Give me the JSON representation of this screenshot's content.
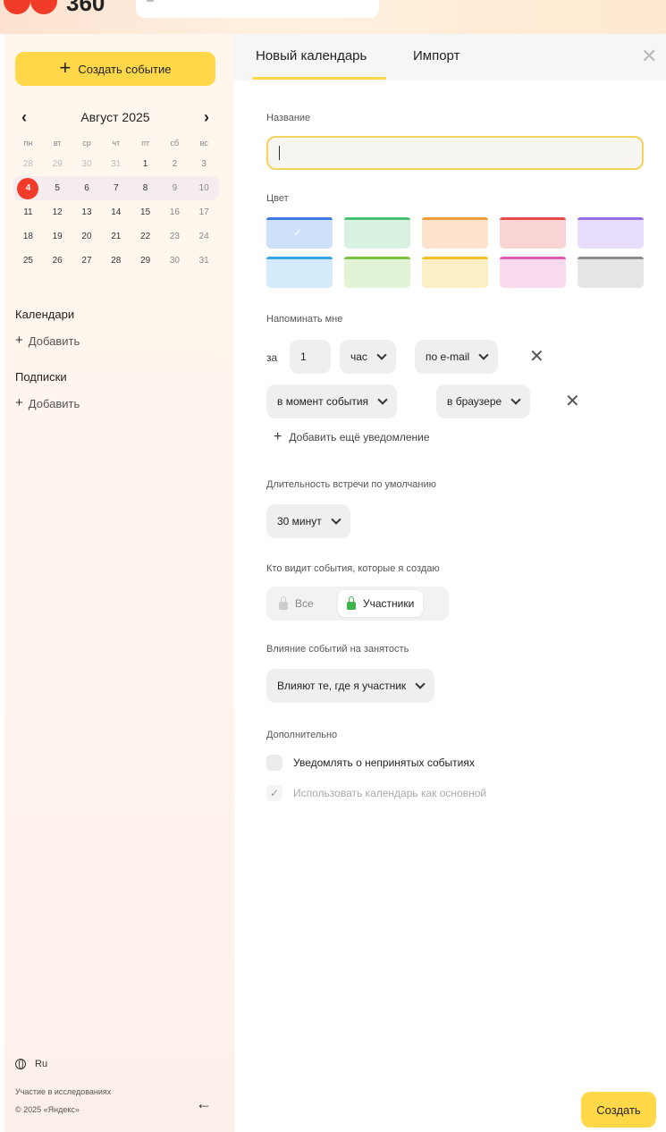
{
  "header": {
    "logo_text": "360"
  },
  "sidebar": {
    "create_button_label": "Создать событие",
    "calendar": {
      "month_label": "Август 2025",
      "weekdays": [
        "пн",
        "вт",
        "ср",
        "чт",
        "пт",
        "сб",
        "вс"
      ],
      "weeks": [
        [
          "28",
          "29",
          "30",
          "31",
          "1",
          "2",
          "3"
        ],
        [
          "4",
          "5",
          "6",
          "7",
          "8",
          "9",
          "10"
        ],
        [
          "11",
          "12",
          "13",
          "14",
          "15",
          "16",
          "17"
        ],
        [
          "18",
          "19",
          "20",
          "21",
          "22",
          "23",
          "24"
        ],
        [
          "25",
          "26",
          "27",
          "28",
          "29",
          "30",
          "31"
        ]
      ],
      "today": "4"
    },
    "calendars_title": "Календари",
    "calendars_add": "Добавить",
    "subscriptions_title": "Подписки",
    "subscriptions_add": "Добавить",
    "language": "Ru",
    "research_link": "Участие в исследованиях",
    "copyright": "© 2025 «Яндекс»"
  },
  "panel": {
    "tabs": [
      "Новый календарь",
      "Импорт"
    ],
    "name_label": "Название",
    "name_value": "",
    "color_label": "Цвет",
    "colors": [
      {
        "bg": "#cfe0fb",
        "bar": "#3a7be6"
      },
      {
        "bg": "#d9f2e1",
        "bar": "#46c16f"
      },
      {
        "bg": "#fde3cc",
        "bar": "#f39a3a"
      },
      {
        "bg": "#f9d4d4",
        "bar": "#e54b4b"
      },
      {
        "bg": "#e8dcfb",
        "bar": "#9a6de8"
      },
      {
        "bg": "#d3ebfa",
        "bar": "#34a4e4"
      },
      {
        "bg": "#e3f3d5",
        "bar": "#7cc242"
      },
      {
        "bg": "#fdefc5",
        "bar": "#f2c12a"
      },
      {
        "bg": "#f9d9ee",
        "bar": "#e058b2"
      },
      {
        "bg": "#e6e6e6",
        "bar": "#8c8c8c"
      }
    ],
    "remind_label": "Напоминать мне",
    "reminder1": {
      "prefix": "за",
      "amount": "1",
      "unit": "час",
      "channel": "по e-mail"
    },
    "reminder2": {
      "when": "в момент события",
      "channel": "в браузере"
    },
    "add_reminder": "Добавить ещё уведомление",
    "duration_label": "Длительность встречи по умолчанию",
    "duration_value": "30 минут",
    "visibility_label": "Кто видит события, которые я создаю",
    "visibility_options": [
      "Все",
      "Участники"
    ],
    "busy_label": "Влияние событий на занятость",
    "busy_value": "Влияют те, где я участник",
    "extra_label": "Дополнительно",
    "notify_unaccepted": "Уведомлять о непринятых событиях",
    "use_as_primary": "Использовать календарь как основной",
    "submit_label": "Создать"
  }
}
